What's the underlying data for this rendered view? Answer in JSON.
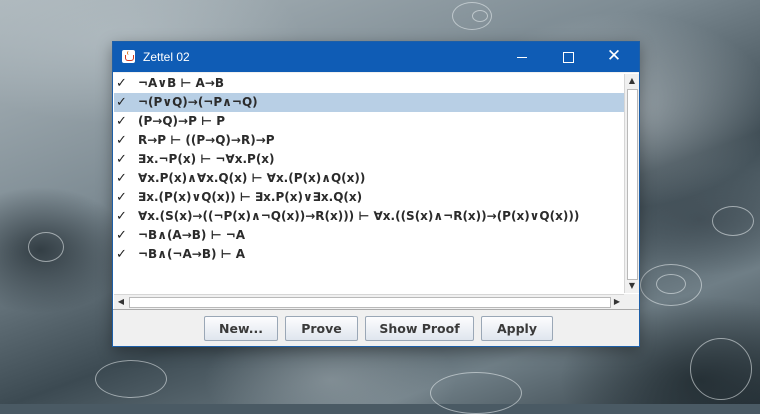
{
  "window": {
    "title": "Zettel 02",
    "controls": {
      "minimize": "minimize",
      "maximize": "maximize",
      "close": "✕"
    }
  },
  "list": {
    "check_glyph": "✓",
    "selected_index": 1,
    "items": [
      {
        "formula": "¬A∨B ⊢ A→B",
        "checked": true
      },
      {
        "formula": "¬(P∨Q)→(¬P∧¬Q)",
        "checked": true
      },
      {
        "formula": "(P→Q)→P ⊢ P",
        "checked": true
      },
      {
        "formula": "R→P ⊢ ((P→Q)→R)→P",
        "checked": true
      },
      {
        "formula": "∃x.¬P(x) ⊢ ¬∀x.P(x)",
        "checked": true
      },
      {
        "formula": "∀x.P(x)∧∀x.Q(x) ⊢ ∀x.(P(x)∧Q(x))",
        "checked": true
      },
      {
        "formula": "∃x.(P(x)∨Q(x)) ⊢ ∃x.P(x)∨∃x.Q(x)",
        "checked": true
      },
      {
        "formula": "∀x.(S(x)→((¬P(x)∧¬Q(x))→R(x))) ⊢ ∀x.((S(x)∧¬R(x))→(P(x)∨Q(x)))",
        "checked": true
      },
      {
        "formula": "¬B∧(A→B) ⊢ ¬A",
        "checked": true
      },
      {
        "formula": "¬B∧(¬A→B) ⊢ A",
        "checked": true
      }
    ]
  },
  "scroll_arrows": {
    "up": "▲",
    "down": "▼",
    "left": "◀",
    "right": "▶"
  },
  "buttons": {
    "new": "New...",
    "prove": "Prove",
    "show_proof": "Show Proof",
    "apply": "Apply"
  },
  "colors": {
    "titlebar": "#0f5cb5",
    "selection": "#b8cfe5",
    "window_bg": "#f0f0f0"
  }
}
